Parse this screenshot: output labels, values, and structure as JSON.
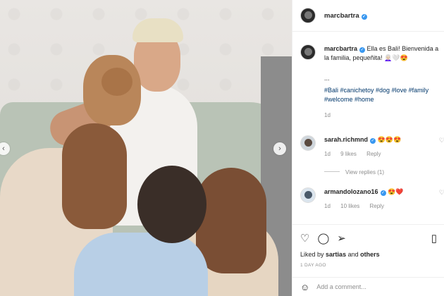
{
  "post": {
    "username": "marcbartra",
    "caption_prefix": "marcbartra",
    "caption_text": "Ella es Bali! Bienvenida a la familia, pequeñita! 👩🏻‍🦳🤍😍",
    "caption_dots": "...",
    "hashtags": "#Bali #canichetoy #dog #love #family #welcome #home",
    "caption_time": "1d"
  },
  "comments": [
    {
      "username": "sarah.richmnd",
      "text": "😍😍😍",
      "time": "1d",
      "likes": "9 likes",
      "reply": "Reply"
    },
    {
      "username": "armandolozano16",
      "text": "😍❤️",
      "time": "1d",
      "likes": "10 likes",
      "reply": "Reply"
    }
  ],
  "view_replies": "View replies (1)",
  "liked_by": {
    "prefix": "Liked by",
    "user": "sartias",
    "mid": "and",
    "others": "others"
  },
  "timestamp": "1 DAY AGO",
  "add_comment": {
    "placeholder": "Add a comment..."
  },
  "icons": {
    "like": "heart-icon",
    "comment": "comment-icon",
    "share": "paper-plane-icon",
    "save": "bookmark-icon",
    "emoji": "smiley-icon",
    "prev": "chevron-left-icon",
    "next": "chevron-right-icon"
  },
  "colors": {
    "verified": "#3897f0",
    "hashtag": "#00376b",
    "muted": "#8e8e8e"
  }
}
